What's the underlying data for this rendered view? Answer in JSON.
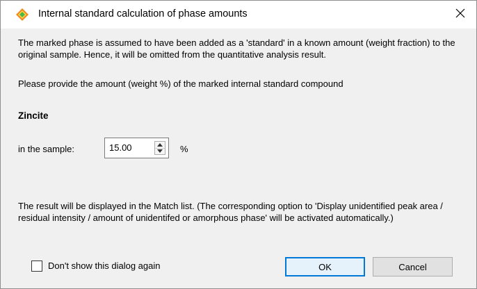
{
  "window": {
    "title": "Internal standard calculation of phase amounts",
    "close_glyph": "✕",
    "icon": "diamond-app-icon"
  },
  "dialog": {
    "description": "The marked phase is assumed to have been added as a 'standard' in a known amount (weight fraction) to the original sample. Hence, it will be omitted from the quantitative analysis result.",
    "prompt": "Please provide the amount (weight %) of the marked internal standard compound",
    "compound_name": "Zincite",
    "sample_label": "in the sample:",
    "amount_value": "15.00",
    "unit": "%",
    "result_note": "The result will be displayed in the Match list. (The corresponding option to 'Display unidentified peak area / residual intensity / amount of unidentifed or amorphous phase' will be activated automatically.)",
    "dont_show_label": "Don't show this dialog again",
    "dont_show_checked": false
  },
  "buttons": {
    "ok_label": "OK",
    "cancel_label": "Cancel"
  },
  "colors": {
    "client_background": "#f0f0f0",
    "default_button_border": "#0078d7",
    "icon_orange": "#f08a1c",
    "icon_green": "#48b84a"
  }
}
